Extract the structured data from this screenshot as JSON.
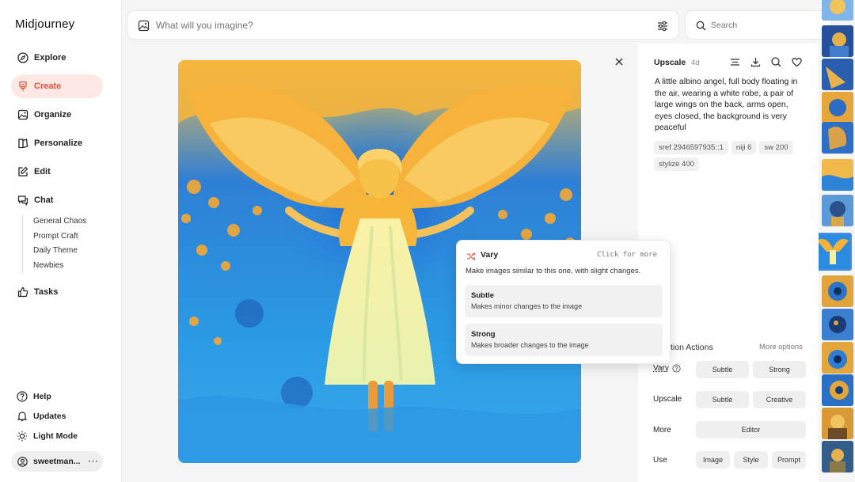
{
  "app": {
    "title": "Midjourney"
  },
  "sidebar": {
    "nav": [
      {
        "label": "Explore",
        "icon": "compass-icon"
      },
      {
        "label": "Create",
        "icon": "brush-icon",
        "active": true
      },
      {
        "label": "Organize",
        "icon": "image-icon"
      },
      {
        "label": "Personalize",
        "icon": "book-icon"
      },
      {
        "label": "Edit",
        "icon": "edit-icon"
      },
      {
        "label": "Chat",
        "icon": "chat-icon"
      }
    ],
    "chat_rooms": [
      "General Chaos",
      "Prompt Craft",
      "Daily Theme",
      "Newbies"
    ],
    "tasks": {
      "label": "Tasks",
      "icon": "thumbs-up-icon"
    },
    "footer": [
      {
        "label": "Help",
        "icon": "help-icon"
      },
      {
        "label": "Updates",
        "icon": "bell-icon"
      },
      {
        "label": "Light Mode",
        "icon": "sun-icon"
      }
    ],
    "user": {
      "name": "sweetman...",
      "menu": "···"
    }
  },
  "topbar": {
    "imagine_placeholder": "What will you imagine?",
    "search_placeholder": "Search"
  },
  "panel": {
    "title": "Upscale",
    "age": "4d",
    "prompt": "A little albino angel, full body floating in the air, wearing a white robe, a pair of large wings on the back, arms open, eyes closed, the background is very peaceful",
    "tags": [
      "sref 2946597935::1",
      "niji 6",
      "sw 200",
      "stylize 400"
    ],
    "actions_title": "tion Actions",
    "more_options": "More options",
    "rows": {
      "vary": {
        "label": "Vary",
        "buttons": [
          "Subtle",
          "Strong"
        ]
      },
      "upscale": {
        "label": "Upscale",
        "buttons": [
          "Subtle",
          "Creative"
        ]
      },
      "more": {
        "label": "More",
        "buttons": [
          "Editor"
        ]
      },
      "use": {
        "label": "Use",
        "buttons": [
          "Image",
          "Style",
          "Prompt"
        ]
      }
    }
  },
  "popup": {
    "title": "Vary",
    "hint": "Click for more",
    "description": "Make images similar to this one, with slight changes.",
    "options": [
      {
        "title": "Subtle",
        "description": "Makes minor changes to the image"
      },
      {
        "title": "Strong",
        "description": "Makes broader changes to the image"
      }
    ]
  },
  "colors": {
    "accent": "#e8503a",
    "accent_bg": "#fde8e4",
    "image_blue": "#2a8be0",
    "image_gold": "#f3b23a"
  }
}
